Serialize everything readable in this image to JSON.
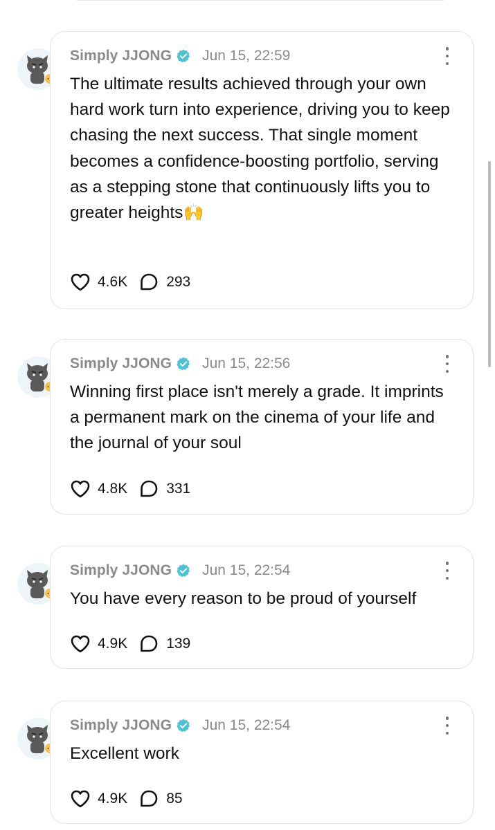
{
  "posts": [
    {
      "author": "Simply JJONG",
      "time": "Jun 15, 22:59",
      "text": "The ultimate results achieved through your own hard work turn into experience, driving you to keep chasing the next success. That single moment becomes a confidence-boosting portfolio, serving as a stepping stone that continuously lifts you to greater heights",
      "emoji": "🙌",
      "likes": "4.6K",
      "comments": "293"
    },
    {
      "author": "Simply JJONG",
      "time": "Jun 15, 22:56",
      "text": "Winning first place isn't merely a grade. It imprints a permanent mark on the cinema of your life and the journal of your soul",
      "likes": "4.8K",
      "comments": "331"
    },
    {
      "author": "Simply JJONG",
      "time": "Jun 15, 22:54",
      "text": "You have every reason to be proud of yourself",
      "likes": "4.9K",
      "comments": "139"
    },
    {
      "author": "Simply JJONG",
      "time": "Jun 15, 22:54",
      "text": "Excellent work",
      "likes": "4.9K",
      "comments": "85"
    }
  ],
  "icons": {
    "verified": "verified-badge-icon",
    "like": "heart-icon",
    "comment": "speech-bubble-icon",
    "more": "more-vertical-icon"
  },
  "colors": {
    "verified": "#4fc3d6",
    "meta_text": "#8a8a8a",
    "card_border": "#e3e3e3"
  }
}
